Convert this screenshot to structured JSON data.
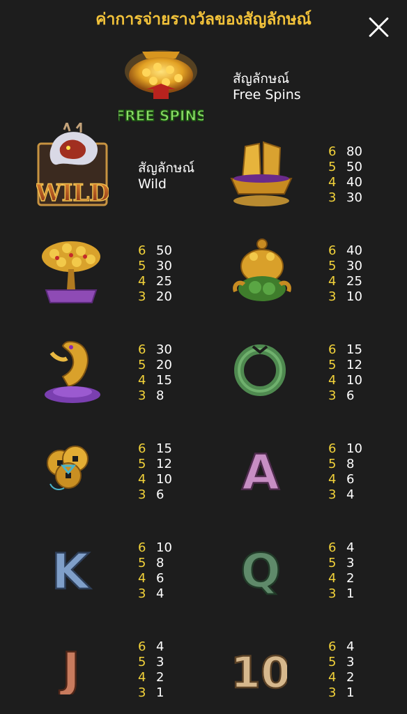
{
  "title": "ค่าการจ่ายรางวัลของสัญลักษณ์",
  "close_icon": "close-icon",
  "colors": {
    "background": "#1d1d1d",
    "title": "#f2c23a",
    "count": "#f2d23a",
    "value": "#ffffff"
  },
  "free_spins": {
    "icon": "gold-coin-tree-icon",
    "icon_text": "FREE SPINS",
    "label_line1": "สัญลักษณ์",
    "label_line2": "Free Spins"
  },
  "wild": {
    "icon": "dragon-wild-icon",
    "icon_text": "WILD",
    "label_line1": "สัญลักษณ์",
    "label_line2": "Wild"
  },
  "symbols": [
    {
      "name": "gold-ship",
      "pays": [
        {
          "count": "6",
          "value": "80"
        },
        {
          "count": "5",
          "value": "50"
        },
        {
          "count": "4",
          "value": "40"
        },
        {
          "count": "3",
          "value": "30"
        }
      ]
    },
    {
      "name": "money-tree",
      "pays": [
        {
          "count": "6",
          "value": "50"
        },
        {
          "count": "5",
          "value": "30"
        },
        {
          "count": "4",
          "value": "25"
        },
        {
          "count": "3",
          "value": "20"
        }
      ]
    },
    {
      "name": "golden-toad",
      "pays": [
        {
          "count": "6",
          "value": "40"
        },
        {
          "count": "5",
          "value": "30"
        },
        {
          "count": "4",
          "value": "25"
        },
        {
          "count": "3",
          "value": "10"
        }
      ]
    },
    {
      "name": "golden-carp",
      "pays": [
        {
          "count": "6",
          "value": "30"
        },
        {
          "count": "5",
          "value": "20"
        },
        {
          "count": "4",
          "value": "15"
        },
        {
          "count": "3",
          "value": "8"
        }
      ]
    },
    {
      "name": "jade-ring",
      "pays": [
        {
          "count": "6",
          "value": "15"
        },
        {
          "count": "5",
          "value": "12"
        },
        {
          "count": "4",
          "value": "10"
        },
        {
          "count": "3",
          "value": "6"
        }
      ]
    },
    {
      "name": "coins",
      "pays": [
        {
          "count": "6",
          "value": "15"
        },
        {
          "count": "5",
          "value": "12"
        },
        {
          "count": "4",
          "value": "10"
        },
        {
          "count": "3",
          "value": "6"
        }
      ]
    },
    {
      "name": "letter-a",
      "letter": "A",
      "pays": [
        {
          "count": "6",
          "value": "10"
        },
        {
          "count": "5",
          "value": "8"
        },
        {
          "count": "4",
          "value": "6"
        },
        {
          "count": "3",
          "value": "4"
        }
      ]
    },
    {
      "name": "letter-k",
      "letter": "K",
      "pays": [
        {
          "count": "6",
          "value": "10"
        },
        {
          "count": "5",
          "value": "8"
        },
        {
          "count": "4",
          "value": "6"
        },
        {
          "count": "3",
          "value": "4"
        }
      ]
    },
    {
      "name": "letter-q",
      "letter": "Q",
      "pays": [
        {
          "count": "6",
          "value": "4"
        },
        {
          "count": "5",
          "value": "3"
        },
        {
          "count": "4",
          "value": "2"
        },
        {
          "count": "3",
          "value": "1"
        }
      ]
    },
    {
      "name": "letter-j",
      "letter": "J",
      "pays": [
        {
          "count": "6",
          "value": "4"
        },
        {
          "count": "5",
          "value": "3"
        },
        {
          "count": "4",
          "value": "2"
        },
        {
          "count": "3",
          "value": "1"
        }
      ]
    },
    {
      "name": "number-10",
      "letter": "10",
      "pays": [
        {
          "count": "6",
          "value": "4"
        },
        {
          "count": "5",
          "value": "3"
        },
        {
          "count": "4",
          "value": "2"
        },
        {
          "count": "3",
          "value": "1"
        }
      ]
    }
  ]
}
